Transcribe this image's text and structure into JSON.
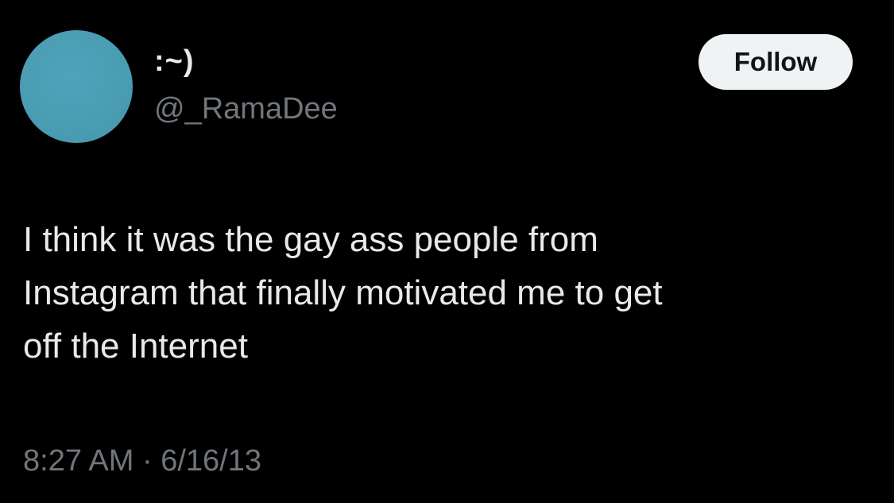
{
  "user": {
    "display_name": ":~)",
    "handle": "@_RamaDee",
    "avatar_color": "#4a9db3"
  },
  "follow_button": {
    "label": "Follow"
  },
  "tweet": {
    "lines": [
      "I think it was the gay ass people from",
      "Instagram that finally motivated me to get",
      "off the Internet"
    ]
  },
  "meta": {
    "time": "8:27 AM",
    "separator": "·",
    "date": "6/16/13"
  },
  "colors": {
    "background": "#000000",
    "primary_text": "#e7e9ea",
    "secondary_text": "#71767b",
    "button_bg": "#eff3f4",
    "button_text": "#0f1419"
  }
}
